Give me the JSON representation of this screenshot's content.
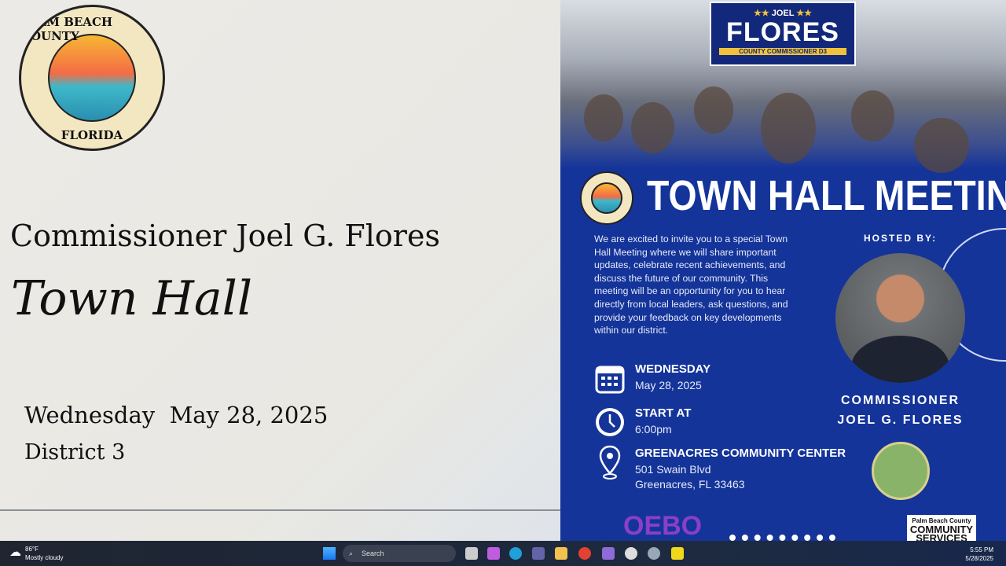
{
  "left": {
    "seal_text": [
      "PALM BEACH COUNTY",
      "FLORIDA"
    ],
    "title": "Commissioner Joel G. Flores",
    "subtitle": "Town Hall",
    "date": "Wednesday  May 28, 2025",
    "district": "District 3"
  },
  "flyer": {
    "brand_first": "JOEL",
    "brand_last": "FLORES",
    "brand_role": "COUNTY COMMISSIONER D3",
    "headline": "TOWN HALL MEETING",
    "intro": "We are excited to invite you to a special Town Hall Meeting where we will share important updates, celebrate recent achievements, and discuss the future of our community. This meeting will be an opportunity for you to hear directly from local leaders, ask questions, and provide your feedback on key developments within our district.",
    "hosted_by": "HOSTED BY:",
    "host_line1": "COMMISSIONER",
    "host_line2": "JOEL G. FLORES",
    "day_label": "WEDNESDAY",
    "day_value": "May 28, 2025",
    "time_label": "START AT",
    "time_value": "6:00pm",
    "venue": "GREENACRES COMMUNITY CENTER",
    "address1": "501 Swain Blvd",
    "address2": "Greenacres, FL 33463",
    "logos": [
      "OEBO",
      "Palm Beach County",
      "COMMUNITY SERVICES"
    ]
  },
  "taskbar": {
    "weather_temp": "86°F",
    "weather_desc": "Mostly cloudy",
    "search_placeholder": "Search",
    "time": "5:55 PM",
    "date": "5/28/2025"
  },
  "colors": {
    "flyer_blue": "#14349a",
    "gold": "#f0c23c"
  }
}
